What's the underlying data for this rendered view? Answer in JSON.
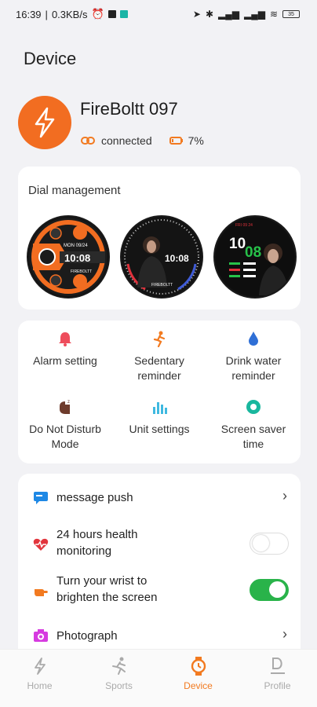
{
  "status_bar": {
    "time": "16:39",
    "speed": "0.3KB/s",
    "battery": "35"
  },
  "page": {
    "title": "Device"
  },
  "device": {
    "name": "FireBoltt 097",
    "connection": "connected",
    "battery": "7%"
  },
  "dial_management": {
    "title": "Dial management",
    "dials": [
      {
        "name": "orange-sport-dial",
        "time": "10:08"
      },
      {
        "name": "portrait-dial",
        "time": "10:08"
      },
      {
        "name": "digital-portrait-dial",
        "hour": "10",
        "minute": "08"
      }
    ]
  },
  "features": [
    {
      "label1": "Alarm setting",
      "label2": "",
      "icon": "alarm-bell-icon"
    },
    {
      "label1": "Sedentary",
      "label2": "reminder",
      "icon": "sedentary-icon"
    },
    {
      "label1": "Drink water",
      "label2": "reminder",
      "icon": "water-drop-icon"
    },
    {
      "label1": "Do Not Disturb",
      "label2": "Mode",
      "icon": "do-not-disturb-icon"
    },
    {
      "label1": "Unit settings",
      "label2": "",
      "icon": "unit-settings-icon"
    },
    {
      "label1": "Screen saver",
      "label2": "time",
      "icon": "screen-saver-icon"
    }
  ],
  "settings": [
    {
      "line1": "message push",
      "line2": "",
      "control": "chevron"
    },
    {
      "line1": "24 hours health",
      "line2": "monitoring",
      "control": "toggle",
      "on": false
    },
    {
      "line1": "Turn your wrist to",
      "line2": "brighten the screen",
      "control": "toggle",
      "on": true
    },
    {
      "line1": "Photograph",
      "line2": "",
      "control": "chevron"
    }
  ],
  "nav": [
    {
      "label": "Home",
      "active": false
    },
    {
      "label": "Sports",
      "active": false
    },
    {
      "label": "Device",
      "active": true
    },
    {
      "label": "Profile",
      "active": false
    }
  ],
  "colors": {
    "accent": "#f27a20",
    "toggle_on": "#29b34a",
    "background": "#f2f2f5"
  }
}
